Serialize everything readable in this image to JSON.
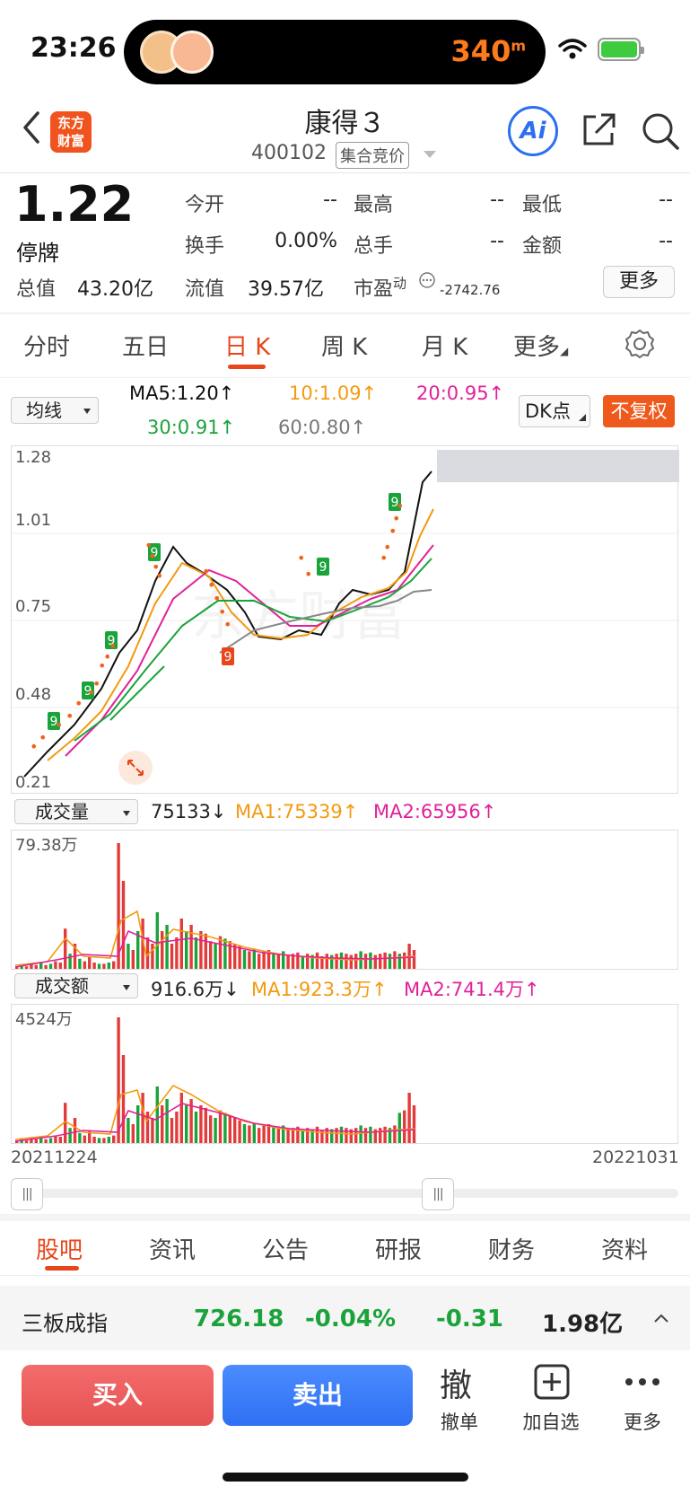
{
  "status_bar": {
    "time": "23:26",
    "speed_value": "340",
    "speed_unit": "m"
  },
  "header": {
    "stock_name": "康得３",
    "stock_code": "400102",
    "auction_tag": "集合竞价",
    "logo_line1": "东方",
    "logo_line2": "财富",
    "ai_label": "Ai"
  },
  "quote": {
    "price": "1.22",
    "status": "停牌",
    "total_mv_label": "总值",
    "total_mv": "43.20亿",
    "float_mv_label": "流值",
    "float_mv": "39.57亿",
    "pe_label": "市盈",
    "pe_sup": "动",
    "pe_value": "-2742.76",
    "open_label": "今开",
    "open": "--",
    "high_label": "最高",
    "high": "--",
    "low_label": "最低",
    "low": "--",
    "turnover_label": "换手",
    "turnover": "0.00%",
    "volume_label": "总手",
    "volume": "--",
    "amount_label": "金额",
    "amount": "--",
    "more_label": "更多"
  },
  "period_tabs": [
    "分时",
    "五日",
    "日 K",
    "周 K",
    "月 K",
    "更多"
  ],
  "ma_bar": {
    "select_label": "均线",
    "ma5": "MA5:1.20↑",
    "ma10": "10:1.09↑",
    "ma20": "20:0.95↑",
    "ma30": "30:0.91↑",
    "ma60": "60:0.80↑",
    "dk_label": "DK点",
    "fq_label": "不复权"
  },
  "colors": {
    "ma5": "#111111",
    "ma10": "#f39a10",
    "ma20": "#e0219a",
    "ma30": "#1aa33a",
    "ma60": "#888888",
    "up": "#e23b3b",
    "down": "#1aa33a",
    "accent": "#e8461a"
  },
  "price_chart": {
    "y_ticks": [
      "1.28",
      "1.01",
      "0.75",
      "0.48",
      "0.21"
    ]
  },
  "volume_panel": {
    "select_label": "成交量",
    "current": "75133↓",
    "ma1": "MA1:75339↑",
    "ma2": "MA2:65956↑",
    "max_label": "79.38万"
  },
  "amount_panel": {
    "select_label": "成交额",
    "current": "916.6万↓",
    "ma1": "MA1:923.3万↑",
    "ma2": "MA2:741.4万↑",
    "max_label": "4524万"
  },
  "date_range": {
    "start": "20211224",
    "end": "20221031"
  },
  "bottom_tabs": [
    "股吧",
    "资讯",
    "公告",
    "研报",
    "财务",
    "资料"
  ],
  "index_bar": {
    "name": "三板成指",
    "value": "726.18",
    "pct": "-0.04%",
    "change": "-0.31",
    "amount": "1.98亿"
  },
  "actions": {
    "buy": "买入",
    "sell": "卖出",
    "cancel_glyph": "撤",
    "cancel": "撤单",
    "watch": "加自选",
    "more": "更多"
  }
}
